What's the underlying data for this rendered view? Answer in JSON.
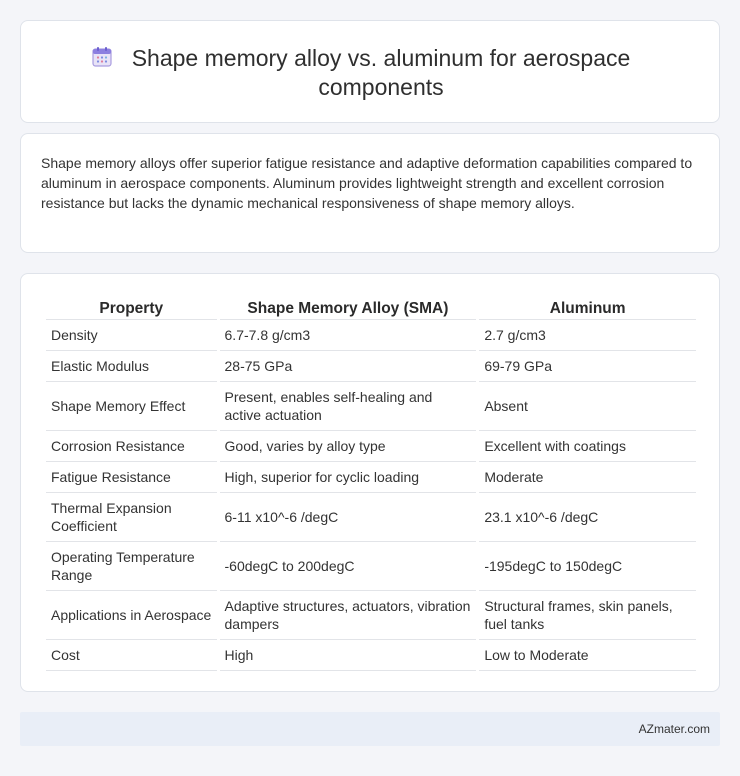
{
  "header": {
    "title": "Shape memory alloy vs. aluminum for aerospace components",
    "icon": "calendar-icon"
  },
  "summary": "Shape memory alloys offer superior fatigue resistance and adaptive deformation capabilities compared to aluminum in aerospace components. Aluminum provides lightweight strength and excellent corrosion resistance but lacks the dynamic mechanical responsiveness of shape memory alloys.",
  "table": {
    "headers": [
      "Property",
      "Shape Memory Alloy (SMA)",
      "Aluminum"
    ],
    "rows": [
      [
        "Density",
        "6.7-7.8 g/cm3",
        "2.7 g/cm3"
      ],
      [
        "Elastic Modulus",
        "28-75 GPa",
        "69-79 GPa"
      ],
      [
        "Shape Memory Effect",
        "Present, enables self-healing and active actuation",
        "Absent"
      ],
      [
        "Corrosion Resistance",
        "Good, varies by alloy type",
        "Excellent with coatings"
      ],
      [
        "Fatigue Resistance",
        "High, superior for cyclic loading",
        "Moderate"
      ],
      [
        "Thermal Expansion Coefficient",
        "6-11 x10^-6 /degC",
        "23.1 x10^-6 /degC"
      ],
      [
        "Operating Temperature Range",
        "-60degC to 200degC",
        "-195degC to 150degC"
      ],
      [
        "Applications in Aerospace",
        "Adaptive structures, actuators, vibration dampers",
        "Structural frames, skin panels, fuel tanks"
      ],
      [
        "Cost",
        "High",
        "Low to Moderate"
      ]
    ]
  },
  "footer": {
    "brand": "AZmater.com"
  }
}
